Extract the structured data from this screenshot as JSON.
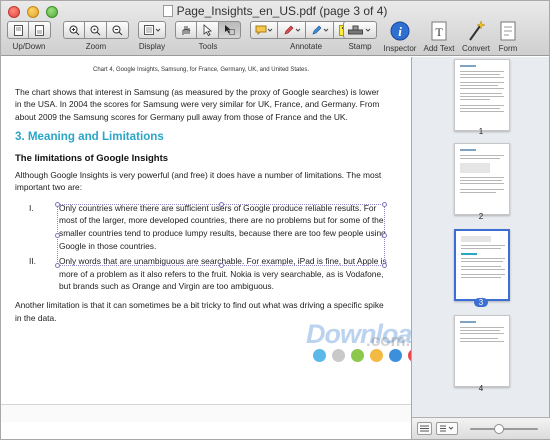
{
  "window": {
    "title": "Page_Insights_en_US.pdf (page 3 of 4)"
  },
  "toolbar": {
    "updown_label": "Up/Down",
    "zoom_label": "Zoom",
    "display_label": "Display",
    "tools_label": "Tools",
    "annotate_label": "Annotate",
    "stamp_label": "Stamp",
    "inspector_label": "Inspector",
    "add_text_label": "Add Text",
    "convert_label": "Convert",
    "form_label": "Form"
  },
  "document": {
    "caption": "Chart 4, Google Insights, Samsung, for France, Germany, UK, and United States.",
    "intro": "The chart shows that interest in Samsung (as measured by the proxy of Google searches) is lower in the USA. In 2004 the scores for Samsung were very similar for UK, France, and Germany. From about 2009 the Samsung scores for Germany pull away from those of France and the UK.",
    "section_heading": "3. Meaning and Limitations",
    "subheading": "The limitations of Google Insights",
    "limitations_intro": "Although Google Insights is very powerful (and free) it does have a number of limitations. The most important two are:",
    "items": [
      {
        "num": "I.",
        "text": "Only countries where there are sufficient users of Google produce reliable results. For most of the larger, more developed countries, there are no problems but for some of the smaller countries tend to produce lumpy results, because there are too few people using Google in those countries."
      },
      {
        "num": "II.",
        "text": "Only words that are unambiguous are searchable. For example, iPad is fine, but Apple is more of a problem as it also refers to the fruit. Nokia is very searchable, as is Vodafone, but brands such as Orange and Virgin are too ambiguous."
      }
    ],
    "closing": "Another limitation is that it can sometimes be a bit tricky to find out what was driving a specific spike in the data."
  },
  "sidebar": {
    "thumbnails": [
      {
        "label": "1",
        "active": false
      },
      {
        "label": "2",
        "active": false
      },
      {
        "label": "3",
        "active": true
      },
      {
        "label": "4",
        "active": false
      }
    ]
  },
  "watermark": {
    "text": "Download",
    "domain": ".com.vn"
  },
  "colors": {
    "accent_heading": "#2aa6c7",
    "selection": "#8f86c8",
    "active_thumb": "#3c6fd1"
  }
}
